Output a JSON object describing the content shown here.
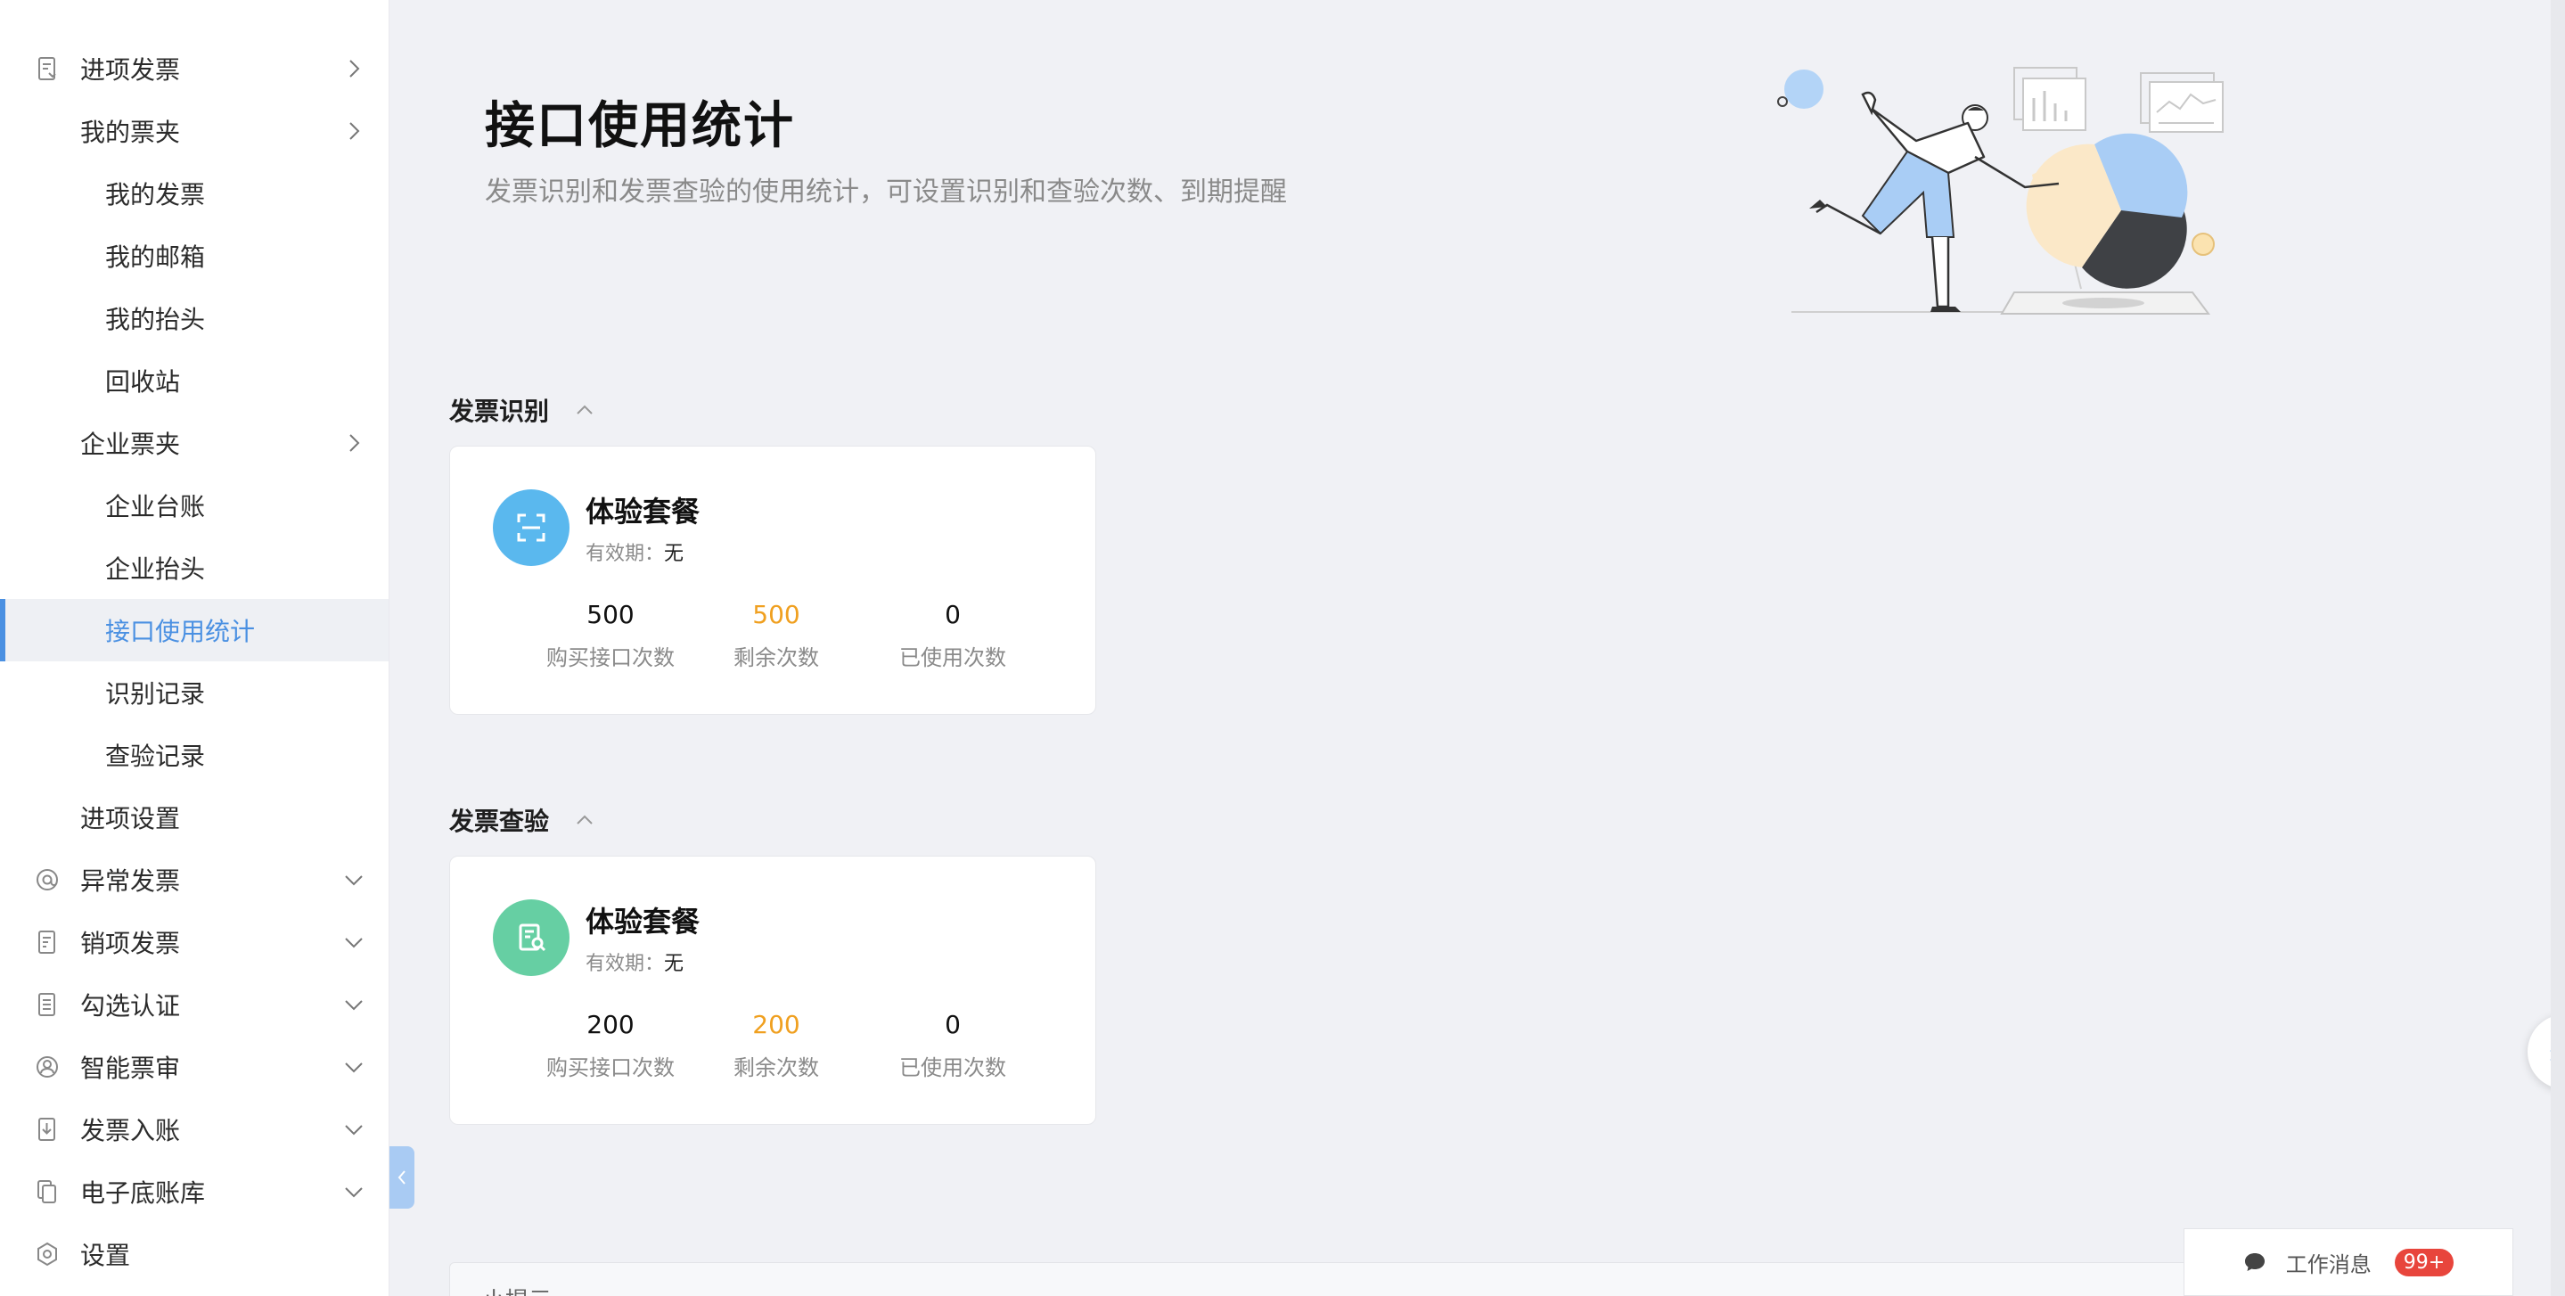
{
  "sidebar": {
    "items": [
      {
        "label": "进项发票",
        "icon": "invoice-in-icon"
      },
      {
        "label": "我的票夹"
      },
      {
        "label": "我的发票"
      },
      {
        "label": "我的邮箱"
      },
      {
        "label": "我的抬头"
      },
      {
        "label": "回收站"
      },
      {
        "label": "企业票夹"
      },
      {
        "label": "企业台账"
      },
      {
        "label": "企业抬头"
      },
      {
        "label": "接口使用统计"
      },
      {
        "label": "识别记录"
      },
      {
        "label": "查验记录"
      },
      {
        "label": "进项设置"
      },
      {
        "label": "异常发票",
        "icon": "at-icon"
      },
      {
        "label": "销项发票",
        "icon": "invoice-out-icon"
      },
      {
        "label": "勾选认证",
        "icon": "checklist-icon"
      },
      {
        "label": "智能票审",
        "icon": "user-circle-icon"
      },
      {
        "label": "发票入账",
        "icon": "download-doc-icon"
      },
      {
        "label": "电子底账库",
        "icon": "copy-doc-icon"
      },
      {
        "label": "设置",
        "icon": "settings-icon"
      }
    ]
  },
  "header": {
    "title": "接口使用统计",
    "subtitle": "发票识别和发票查验的使用统计，可设置识别和查验次数、到期提醒"
  },
  "sections": [
    {
      "title": "发票识别",
      "card": {
        "plan_name": "体验套餐",
        "validity_label": "有效期：",
        "validity_value": "无",
        "icon_color": "#5ab8ee",
        "stats": [
          {
            "value": "500",
            "label": "购买接口次数"
          },
          {
            "value": "500",
            "label": "剩余次数"
          },
          {
            "value": "0",
            "label": "已使用次数"
          }
        ]
      }
    },
    {
      "title": "发票查验",
      "card": {
        "plan_name": "体验套餐",
        "validity_label": "有效期：",
        "validity_value": "无",
        "icon_color": "#66cfa3",
        "stats": [
          {
            "value": "200",
            "label": "购买接口次数"
          },
          {
            "value": "200",
            "label": "剩余次数"
          },
          {
            "value": "0",
            "label": "已使用次数"
          }
        ]
      }
    }
  ],
  "tip": {
    "label": "小提示"
  },
  "work_message": {
    "label": "工作消息",
    "badge": "99+"
  },
  "colors": {
    "accent": "#4a90e2",
    "highlight": "#f0a020",
    "badge": "#e8453c"
  }
}
